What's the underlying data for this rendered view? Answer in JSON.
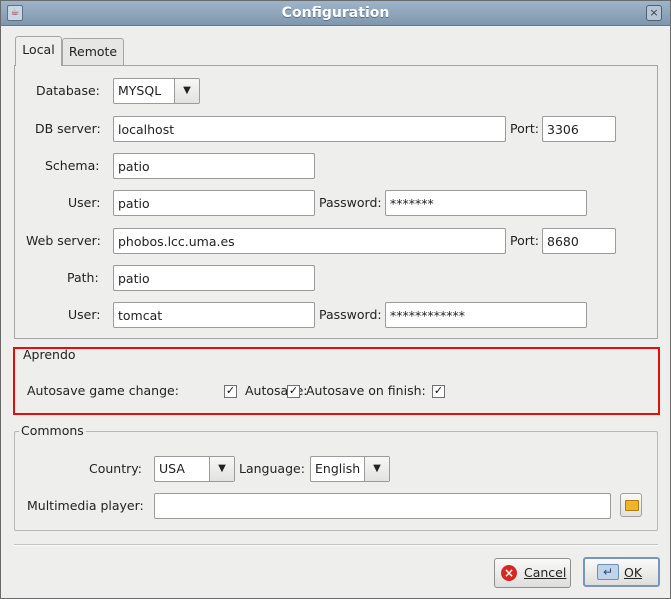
{
  "window": {
    "title": "Configuration",
    "close_glyph": "×"
  },
  "tabs": [
    {
      "label": "Local"
    },
    {
      "label": "Remote"
    }
  ],
  "local": {
    "database_label": "Database:",
    "database_value": "MYSQL",
    "db_server_label": "DB server:",
    "db_server_value": "localhost",
    "db_port_label": "Port:",
    "db_port_value": "3306",
    "schema_label": "Schema:",
    "schema_value": "patio",
    "user_label": "User:",
    "user_value": "patio",
    "password_label": "Password:",
    "password_value": "*******",
    "web_server_label": "Web server:",
    "web_server_value": "phobos.lcc.uma.es",
    "web_port_label": "Port:",
    "web_port_value": "8680",
    "path_label": "Path:",
    "path_value": "patio",
    "web_user_label": "User:",
    "web_user_value": "tomcat",
    "web_password_label": "Password:",
    "web_password_value": "************"
  },
  "aprendo": {
    "title": "Aprendo",
    "autosave_game_change_label": "Autosave game change:",
    "autosave_label": "Autosave:",
    "autosave_on_finish_label": "Autosave on finish:",
    "check_glyph": "✓"
  },
  "commons": {
    "title": "Commons",
    "country_label": "Country:",
    "country_value": "USA",
    "language_label": "Language:",
    "language_value": "English",
    "multimedia_label": "Multimedia player:",
    "multimedia_value": ""
  },
  "buttons": {
    "cancel_label": "Cancel",
    "ok_label": "OK"
  },
  "colors": {
    "highlight_border": "#e01010",
    "titlebar": "#8fa6bb"
  },
  "icons": {
    "cancel": "cancel-icon",
    "ok": "ok-icon",
    "folder": "folder-icon",
    "combo_arrow": "chevron-down-icon"
  }
}
